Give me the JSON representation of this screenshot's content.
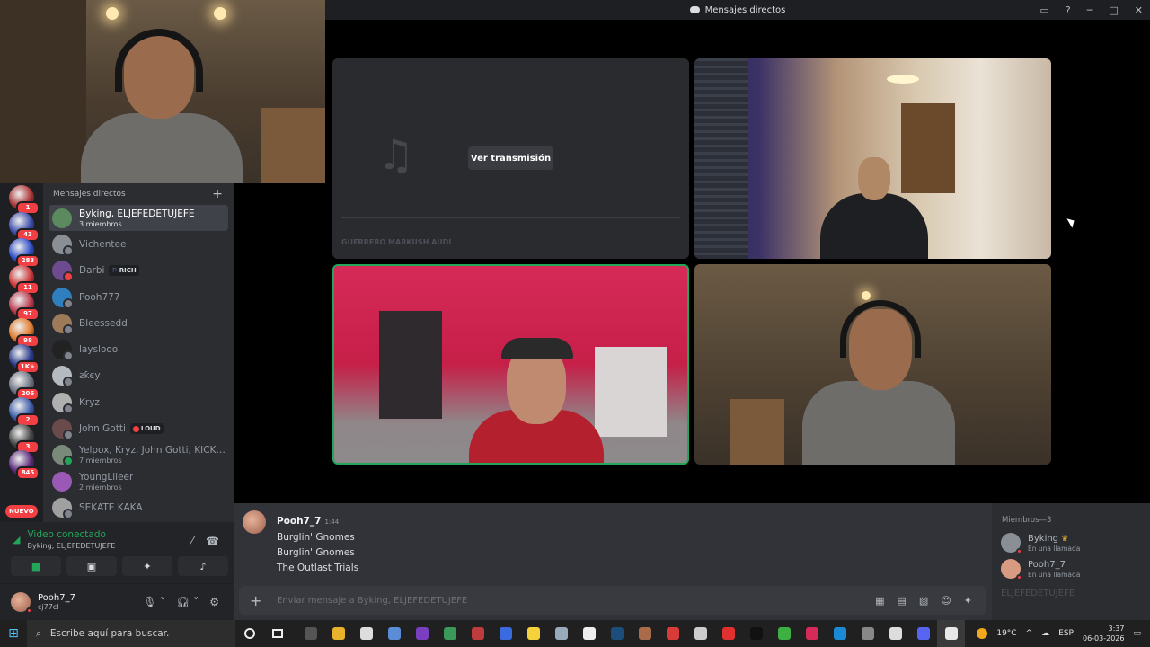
{
  "window": {
    "title": "Mensajes directos"
  },
  "stream": {
    "view_button": "Ver transmisión",
    "title": "GUERRERO MARKUSH AUDI"
  },
  "guilds": [
    {
      "badge": "1",
      "color": "#a33"
    },
    {
      "badge": "43",
      "color": "#3a4ba8"
    },
    {
      "badge": "283",
      "color": "#2b4cc6"
    },
    {
      "badge": "11",
      "color": "#c33"
    },
    {
      "badge": "97",
      "color": "#b8384a"
    },
    {
      "badge": "98",
      "color": "#e07a2a"
    },
    {
      "badge": "1K+",
      "color": "#2a3a8a"
    },
    {
      "badge": "206",
      "color": "#6a7080"
    },
    {
      "badge": "2",
      "color": "#3a5aa8"
    },
    {
      "badge": "3",
      "color": "#444"
    },
    {
      "badge": "845",
      "color": "#5a2a7a"
    }
  ],
  "guild_new_label": "NUEVO",
  "dm": {
    "header": "Mensajes directos",
    "items": [
      {
        "name": "Byking, ELJEFEDETUJEFE",
        "sub": "3 miembros",
        "tag": "",
        "color": "#5b8a5e",
        "status": "none"
      },
      {
        "name": "Vichentee",
        "sub": "",
        "tag": "",
        "color": "#8a8f96",
        "status": "offline"
      },
      {
        "name": "Darbi",
        "sub": "",
        "tag": "RICH",
        "color": "#6e4a8f",
        "status": "dnd"
      },
      {
        "name": "Pooh777",
        "sub": "",
        "tag": "",
        "color": "#2f7fbf",
        "status": "offline"
      },
      {
        "name": "Bleessedd",
        "sub": "",
        "tag": "",
        "color": "#9c7a5a",
        "status": "offline"
      },
      {
        "name": "layslooo",
        "sub": "",
        "tag": "",
        "color": "#222",
        "status": "offline"
      },
      {
        "name": "ꙅƙєу",
        "sub": "",
        "tag": "",
        "color": "#b5bac1",
        "status": "offline"
      },
      {
        "name": "Kryz",
        "sub": "",
        "tag": "",
        "color": "#b0b0b0",
        "status": "offline"
      },
      {
        "name": "John Gotti",
        "sub": "",
        "tag": "LOUD",
        "color": "#6a4a4a",
        "status": "offline"
      },
      {
        "name": "Yelpox, Kryz, John Gotti, KICK BE...",
        "sub": "7 miembros",
        "tag": "",
        "color": "#7a8a7a",
        "status": "online"
      },
      {
        "name": "YoungLiieer",
        "sub": "2 miembros",
        "tag": "",
        "color": "#9b59b6",
        "status": "none"
      },
      {
        "name": "SEKATE KAKA",
        "sub": "",
        "tag": "",
        "color": "#a0a0a0",
        "status": "offline"
      }
    ]
  },
  "voice": {
    "status": "Video conectado",
    "channel": "Byking, ELJEFEDETUJEFE"
  },
  "user": {
    "name": "Pooh7_7",
    "tag": "cj77cl"
  },
  "chat": {
    "author": "Pooh7_7",
    "time": "1:44",
    "lines": [
      "Burglin' Gnomes",
      "Burglin' Gnomes",
      "The Outlast Trials"
    ],
    "composer_placeholder": "Enviar mensaje a Byking, ELJEFEDETUJEFE"
  },
  "members": {
    "header": "Miembros—3",
    "list": [
      {
        "name": "Byking",
        "crown": true,
        "sub": "En una llamada",
        "color": "#8a8f96"
      },
      {
        "name": "Pooh7_7",
        "crown": false,
        "sub": "En una llamada",
        "color": "#d99a82"
      }
    ],
    "ghost": "ELJEFEDETUJEFE"
  },
  "taskbar": {
    "search_placeholder": "Escribe aquí para buscar.",
    "apps": [
      "#555",
      "#e8b22c",
      "#ddd",
      "#5b8dd6",
      "#7a3fc0",
      "#3b9a5a",
      "#c03b3b",
      "#3a6ae0",
      "#f5d23a",
      "#9ab",
      "#eee",
      "#1d4d7a",
      "#aa6b4a",
      "#d93a3a",
      "#ccc",
      "#e03030",
      "#111",
      "#3cb043",
      "#d62a58",
      "#1b8ad6",
      "#888",
      "#ddd",
      "#5865f2",
      "#e8e8e8"
    ],
    "weather": "19°C",
    "lang": "ESP",
    "time": "3:37",
    "date": "06-03-2026"
  }
}
